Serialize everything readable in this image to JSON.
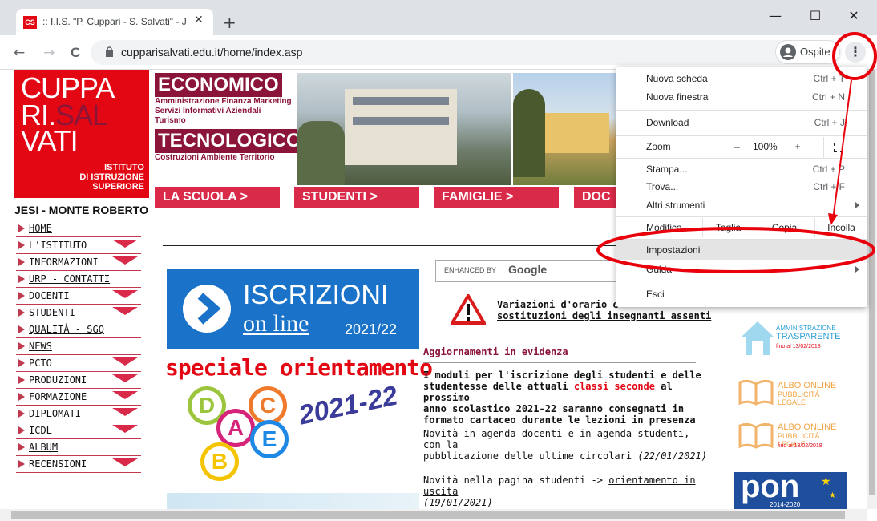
{
  "browser": {
    "tab_title": ":: I.I.S. \"P. Cuppari - S. Salvati\" - Je",
    "favicon_text": "CS",
    "url": "cupparisalvati.edu.it/home/index.asp",
    "profile_label": "Ospite",
    "window_min": "—",
    "window_max": "☐",
    "window_close": "✕",
    "new_tab": "+",
    "tab_close": "✕",
    "back": "←",
    "forward": "→",
    "reload": "C"
  },
  "logo": {
    "line1": "CUPPA",
    "line2a": "RI.",
    "line2b": "SAL",
    "line3": "VATI",
    "sub1": "ISTITUTO",
    "sub2": "DI ISTRUZIONE",
    "sub3": "SUPERIORE"
  },
  "location": "JESI - MONTE ROBERTO",
  "header": {
    "economico": "ECONOMICO",
    "economico_sub1": "Amministrazione Finanza Marketing",
    "economico_sub2": "Servizi Informativi Aziendali",
    "economico_sub3": "Turismo",
    "tecnologico": "TECNOLOGICO",
    "tecnologico_sub": "Costruzioni Ambiente Territorio"
  },
  "nav_tabs": [
    "LA SCUOLA >",
    "STUDENTI >",
    "FAMIGLIE >",
    "DOC"
  ],
  "sidebar": [
    {
      "label": "HOME",
      "link": true,
      "dropdown": false
    },
    {
      "label": "L'ISTITUTO",
      "link": false,
      "dropdown": true
    },
    {
      "label": "INFORMAZIONI",
      "link": false,
      "dropdown": true
    },
    {
      "label": "URP - CONTATTI",
      "link": true,
      "dropdown": false
    },
    {
      "label": "DOCENTI",
      "link": false,
      "dropdown": true
    },
    {
      "label": "STUDENTI",
      "link": false,
      "dropdown": true
    },
    {
      "label": "QUALITÀ - SGQ",
      "link": true,
      "dropdown": false
    },
    {
      "label": "NEWS",
      "link": true,
      "dropdown": false
    },
    {
      "label": "PCTO",
      "link": false,
      "dropdown": true
    },
    {
      "label": "PRODUZIONI",
      "link": false,
      "dropdown": true
    },
    {
      "label": "FORMAZIONE",
      "link": false,
      "dropdown": true
    },
    {
      "label": "DIPLOMATI",
      "link": false,
      "dropdown": true
    },
    {
      "label": "ICDL",
      "link": false,
      "dropdown": true
    },
    {
      "label": "ALBUM",
      "link": true,
      "dropdown": false
    },
    {
      "label": "RECENSIONI",
      "link": false,
      "dropdown": true
    }
  ],
  "iscrizioni": {
    "t1": "ISCRIZIONI",
    "t2": "on line",
    "t3": "2021/22"
  },
  "orientamento": {
    "title": "speciale orientamento",
    "year": "2021-22",
    "letters": [
      "D",
      "C",
      "A",
      "E",
      "B"
    ]
  },
  "search": {
    "label": "ENHANCED BY",
    "brand": "Google"
  },
  "content": {
    "variazioni1": "Variazioni d'orario e",
    "variazioni2": "sostituzioni degli insegnanti assenti",
    "heading": "Aggiornamenti in evidenza",
    "news1_a": "I moduli per l'iscrizione degli studenti e delle",
    "news1_b1": "studentesse delle attuali ",
    "news1_b2": "classi seconde",
    "news1_b3": " al prossimo",
    "news1_c": "anno scolastico 2021-22 saranno consegnati in",
    "news1_d": "formato cartaceo durante le lezioni in presenza",
    "news2_a1": "Novità in ",
    "news2_a2": "agenda docenti",
    "news2_a3": " e in ",
    "news2_a4": "agenda studenti",
    "news2_a5": ", con la",
    "news2_b1": "pubblicazione delle ultime circolari ",
    "news2_b2": "(22/01/2021)",
    "news3_a1": "Novità nella pagina studenti -> ",
    "news3_a2": "orientamento in uscita",
    "news3_b": "(19/01/2021)"
  },
  "right_banners": {
    "amm1": "AMMINISTRAZIONE",
    "amm2": "TRASPARENTE",
    "amm3": "fino al 13/02/2018",
    "albo1": "ALBO ONLINE",
    "albo2": "PUBBLICITÀ LEGALE",
    "albo3": "ALBO ONLINE",
    "albo4": "PUBBLICITÀ LEGALE",
    "albo5": "fino al 13/02/2018",
    "pon": "pon",
    "pon_years": "2014-2020"
  },
  "chrome_menu": {
    "new_tab": "Nuova scheda",
    "new_tab_sc": "Ctrl + T",
    "new_window": "Nuova finestra",
    "new_window_sc": "Ctrl + N",
    "download": "Download",
    "download_sc": "Ctrl + J",
    "zoom": "Zoom",
    "zoom_minus": "–",
    "zoom_value": "100%",
    "zoom_plus": "+",
    "print": "Stampa...",
    "print_sc": "Ctrl + P",
    "find": "Trova...",
    "find_sc": "Ctrl + F",
    "more_tools": "Altri strumenti",
    "edit": "Modifica",
    "cut": "Taglia",
    "copy": "Copia",
    "paste": "Incolla",
    "settings": "Impostazioni",
    "help": "Guida",
    "exit": "Esci"
  },
  "colors": {
    "brand_red": "#e30613",
    "maroon": "#8a1538",
    "annotation_red": "#e8000b"
  }
}
